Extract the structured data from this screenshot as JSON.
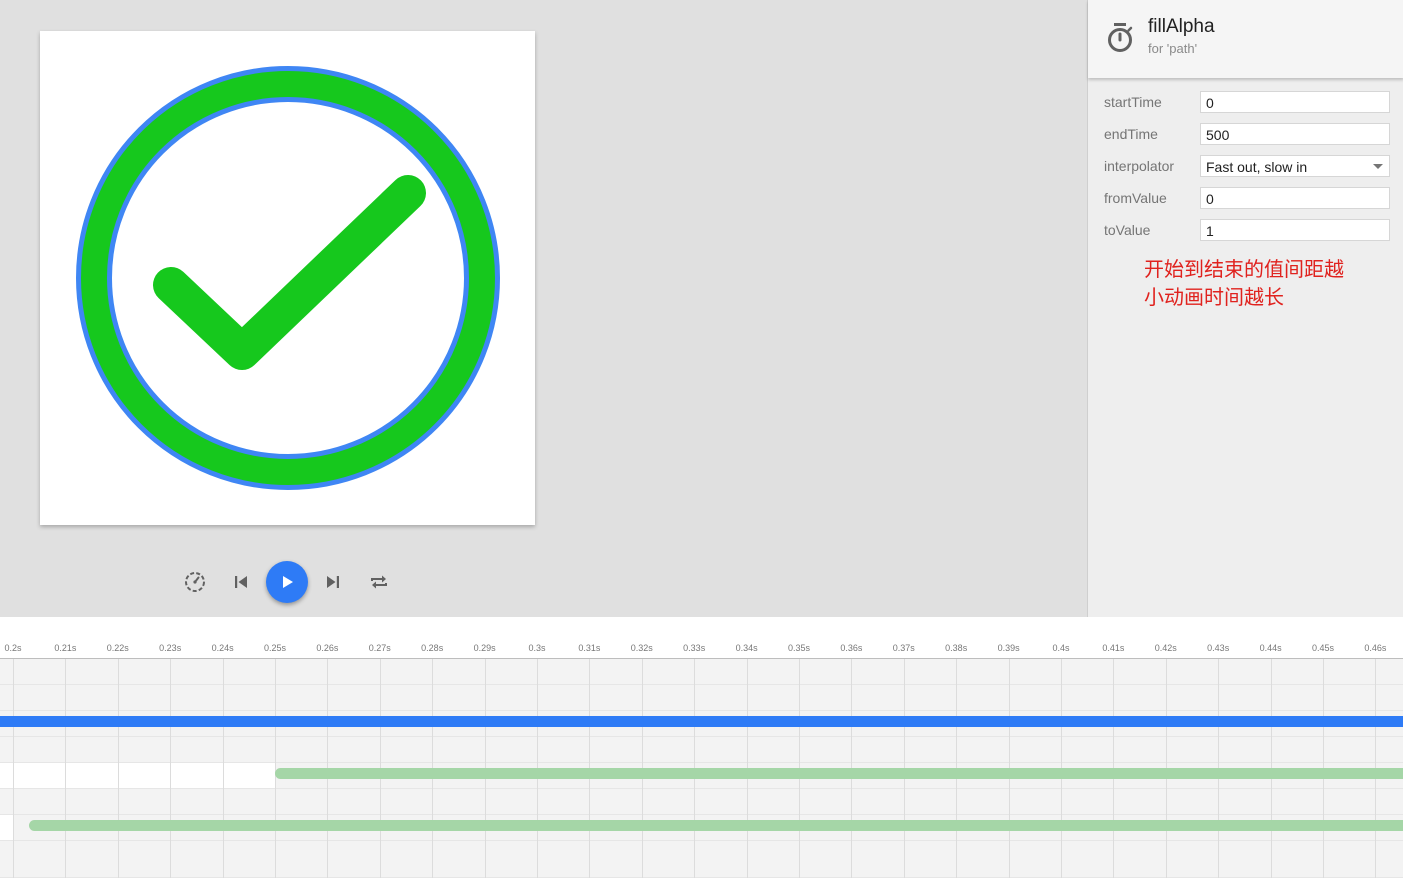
{
  "property": {
    "name": "fillAlpha",
    "target": "for 'path'"
  },
  "fields": [
    {
      "label": "startTime",
      "value": "0",
      "type": "text"
    },
    {
      "label": "endTime",
      "value": "500",
      "type": "text"
    },
    {
      "label": "interpolator",
      "value": "Fast out, slow in",
      "type": "select"
    },
    {
      "label": "fromValue",
      "value": "0",
      "type": "text"
    },
    {
      "label": "toValue",
      "value": "1",
      "type": "text"
    }
  ],
  "annotation": "开始到结束的值间距越\n小动画时间越长",
  "controls": {
    "icons": [
      "speed-icon",
      "skip-previous-icon",
      "play-icon",
      "skip-next-icon",
      "repeat-icon"
    ]
  },
  "colors": {
    "accent": "#2e7bf6",
    "check_green": "#16c81d",
    "circle_stroke": "#3f86f4",
    "bar_blue": "#2e7bf6",
    "bar_green": "#a5d6a7",
    "annotation_red": "#e0221e"
  },
  "timeline": {
    "ticks": [
      "0.2s",
      "0.21s",
      "0.22s",
      "0.23s",
      "0.24s",
      "0.25s",
      "0.26s",
      "0.27s",
      "0.28s",
      "0.29s",
      "0.3s",
      "0.31s",
      "0.32s",
      "0.33s",
      "0.34s",
      "0.35s",
      "0.36s",
      "0.37s",
      "0.38s",
      "0.39s",
      "0.4s",
      "0.41s",
      "0.42s",
      "0.43s",
      "0.44s",
      "0.45s",
      "0.46s"
    ]
  }
}
